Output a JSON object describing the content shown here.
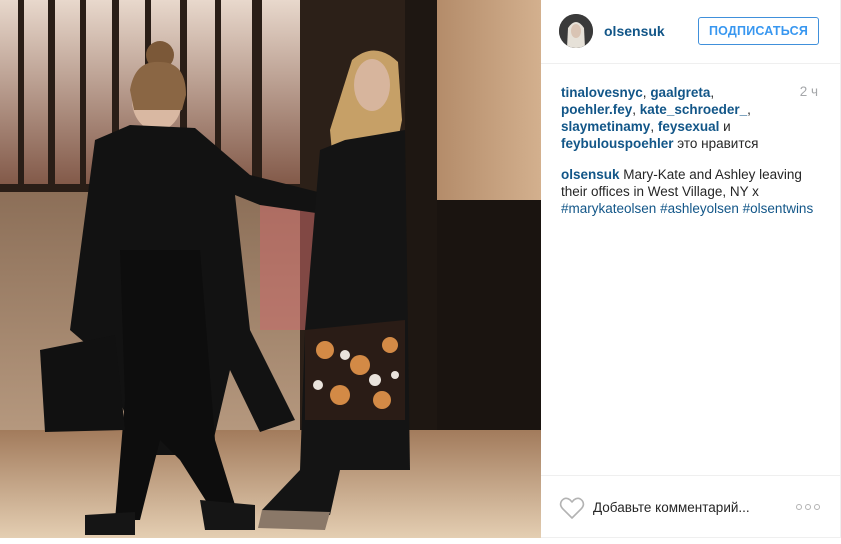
{
  "post": {
    "username": "olsensuk",
    "follow_label": "ПОДПИСАТЬСЯ",
    "time": "2 ч",
    "likes": {
      "users": [
        "tinalovesnyc",
        "gaalgreta",
        "poehler.fey",
        "kate_schroeder_",
        "slaymetinamy",
        "feysexual",
        "feybulouspoehler"
      ],
      "separator": ", ",
      "and_word": " и ",
      "suffix": " это нравится"
    },
    "caption": {
      "author": "olsensuk",
      "text": " Mary-Kate and Ashley leaving their offices in West Village, NY x ",
      "hashtags": [
        "#marykateolsen",
        "#ashleyolsen",
        "#olsentwins"
      ]
    },
    "comment": {
      "placeholder": "Добавьте комментарий..."
    },
    "icons": {
      "like": "heart-outline-icon",
      "more": "more-options-icon"
    },
    "colors": {
      "link": "#125688",
      "follow": "#3897f0",
      "muted": "#a5a7aa"
    }
  }
}
